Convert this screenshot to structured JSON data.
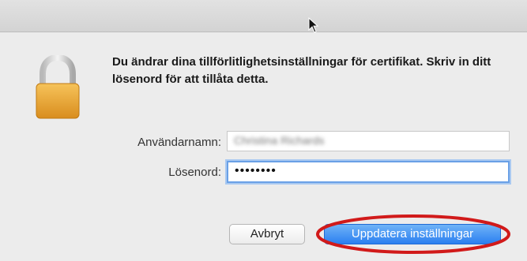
{
  "dialog": {
    "message": "Du ändrar dina tillförlitlighetsinställningar för certifikat. Skriv in ditt lösenord för att tillåta detta.",
    "username_label": "Användarnamn:",
    "username_value": "Christina Richards",
    "password_label": "Lösenord:",
    "password_value": "••••••••",
    "cancel_button": "Avbryt",
    "update_button": "Uppdatera inställningar"
  },
  "icons": {
    "lock": "lock-icon",
    "cursor": "mouse-cursor-icon"
  },
  "colors": {
    "accent": "#2b7ff0",
    "focus_ring": "#6aa0e6",
    "annotation": "#d11a1a",
    "lock_body": "#e8a73a"
  }
}
